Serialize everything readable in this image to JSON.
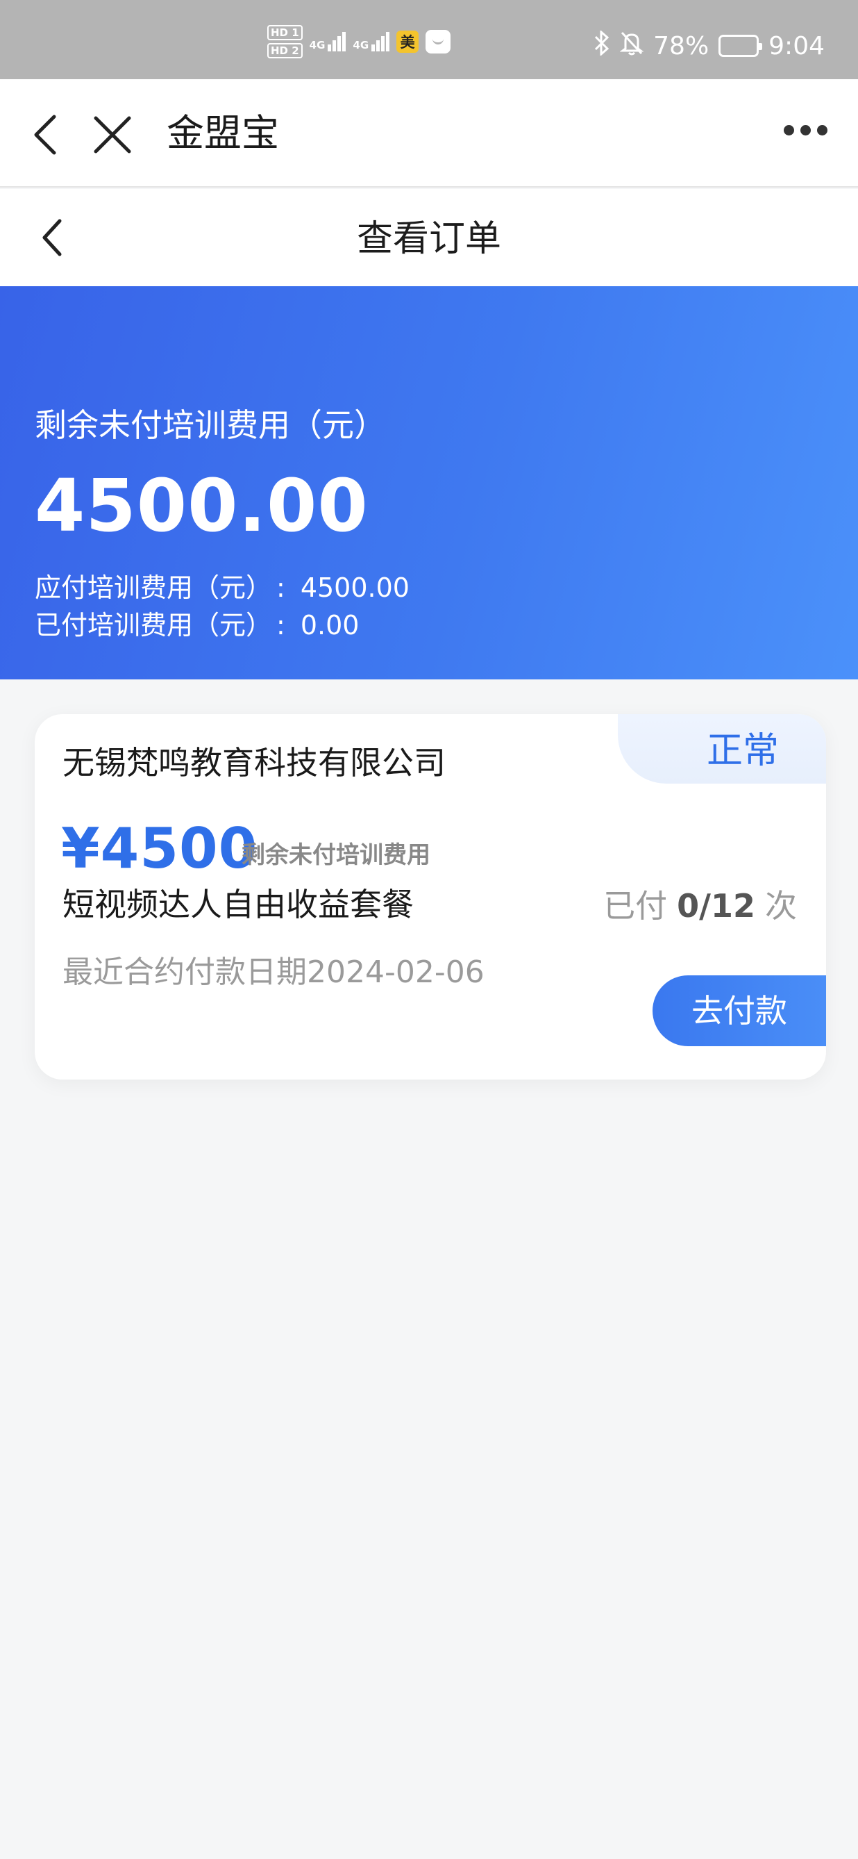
{
  "status_bar": {
    "hd1": "HD 1",
    "hd2": "HD 2",
    "net1": "4G",
    "net2": "4G",
    "app_badge": "美",
    "battery_percent": "78%",
    "time": "9:04",
    "battery_level": 0.78
  },
  "app_bar": {
    "title": "金盟宝"
  },
  "page_header": {
    "title": "查看订单"
  },
  "summary": {
    "remaining_label": "剩余未付培训费用（元）",
    "remaining_amount": "4500.00",
    "payable_label": "应付培训费用（元）",
    "payable_value": "4500.00",
    "paid_label": "已付培训费用（元）",
    "paid_value": "0.00",
    "colon": ":"
  },
  "order": {
    "status": "正常",
    "company": "无锡梵鸣教育科技有限公司",
    "price": "¥4500",
    "price_label": "剩余未付培训费用",
    "package": "短视频达人自由收益套餐",
    "paid_prefix": "已付",
    "paid_count": "0/12",
    "paid_suffix": "次",
    "last_payment": "最近合约付款日期2024-02-06",
    "pay_button": "去付款"
  },
  "colors": {
    "accent": "#2f6fe8",
    "hero_start": "#3863e8",
    "hero_end": "#4b91fa",
    "status_bar": "#b4b4b4"
  },
  "icons": [
    "back-icon",
    "close-icon",
    "more-icon",
    "bluetooth-icon",
    "mute-icon",
    "battery-icon"
  ]
}
